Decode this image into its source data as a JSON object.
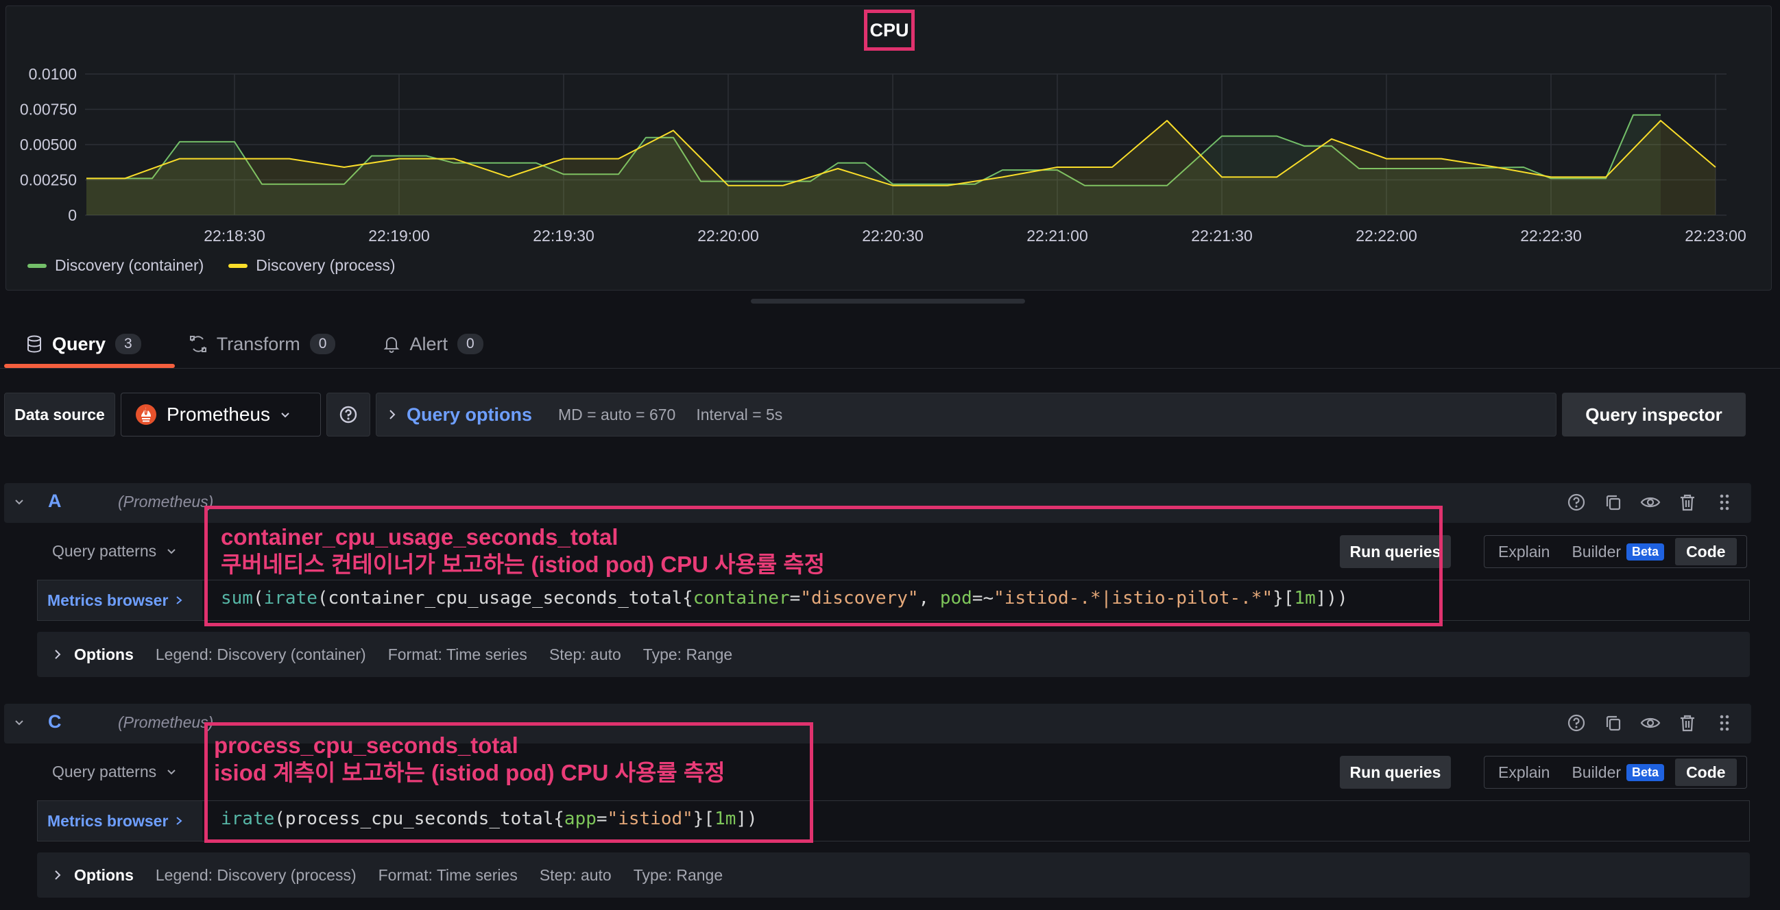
{
  "panel": {
    "title": "CPU",
    "legend": [
      {
        "label": "Discovery (container)",
        "color": "#73bf69"
      },
      {
        "label": "Discovery (process)",
        "color": "#fade2a"
      }
    ]
  },
  "chart_data": {
    "type": "line",
    "title": "CPU",
    "y_ticks": [
      "0.0100",
      "0.00750",
      "0.00500",
      "0.00250",
      "0"
    ],
    "ylim": [
      0,
      0.01
    ],
    "x_ticks": [
      "22:18:30",
      "22:19:00",
      "22:19:30",
      "22:20:00",
      "22:20:30",
      "22:21:00",
      "22:21:30",
      "22:22:00",
      "22:22:30",
      "22:23:00"
    ],
    "grid": true,
    "legend_placement": "bottom-left",
    "series": [
      {
        "name": "Discovery (container)",
        "color": "#73bf69",
        "x": [
          "22:18:03",
          "22:18:15",
          "22:18:20",
          "22:18:30",
          "22:18:35",
          "22:18:50",
          "22:18:55",
          "22:19:05",
          "22:19:10",
          "22:19:25",
          "22:19:30",
          "22:19:40",
          "22:19:45",
          "22:19:50",
          "22:19:55",
          "22:20:05",
          "22:20:15",
          "22:20:20",
          "22:20:25",
          "22:20:30",
          "22:20:45",
          "22:20:50",
          "22:21:00",
          "22:21:05",
          "22:21:20",
          "22:21:30",
          "22:21:40",
          "22:21:45",
          "22:21:50",
          "22:21:55",
          "22:22:10",
          "22:22:25",
          "22:22:30",
          "22:22:40",
          "22:22:45",
          "22:22:50"
        ],
        "values": [
          0.0026,
          0.0026,
          0.0052,
          0.0052,
          0.0022,
          0.0022,
          0.0042,
          0.0042,
          0.0037,
          0.0037,
          0.0029,
          0.0029,
          0.0055,
          0.0055,
          0.0024,
          0.0024,
          0.0024,
          0.0037,
          0.0037,
          0.0022,
          0.0022,
          0.0032,
          0.0032,
          0.0021,
          0.0021,
          0.0056,
          0.0056,
          0.0049,
          0.0049,
          0.0033,
          0.0033,
          0.0034,
          0.0026,
          0.0026,
          0.0071,
          0.0071
        ]
      },
      {
        "name": "Discovery (process)",
        "color": "#fade2a",
        "x": [
          "22:18:03",
          "22:18:10",
          "22:18:20",
          "22:18:30",
          "22:18:40",
          "22:18:50",
          "22:19:00",
          "22:19:10",
          "22:19:20",
          "22:19:30",
          "22:19:40",
          "22:19:50",
          "22:20:00",
          "22:20:10",
          "22:20:20",
          "22:20:30",
          "22:20:40",
          "22:20:50",
          "22:21:00",
          "22:21:10",
          "22:21:20",
          "22:21:30",
          "22:21:40",
          "22:21:50",
          "22:22:00",
          "22:22:10",
          "22:22:20",
          "22:22:30",
          "22:22:40",
          "22:22:50",
          "22:23:00"
        ],
        "values": [
          0.0026,
          0.0026,
          0.004,
          0.004,
          0.004,
          0.0034,
          0.004,
          0.004,
          0.0027,
          0.004,
          0.004,
          0.006,
          0.0021,
          0.0021,
          0.0033,
          0.0021,
          0.0021,
          0.0027,
          0.0034,
          0.0034,
          0.0067,
          0.0027,
          0.0027,
          0.0054,
          0.004,
          0.004,
          0.0034,
          0.0027,
          0.0027,
          0.0067,
          0.0034
        ]
      }
    ]
  },
  "tabs": [
    {
      "label": "Query",
      "count": "3"
    },
    {
      "label": "Transform",
      "count": "0"
    },
    {
      "label": "Alert",
      "count": "0"
    }
  ],
  "datasource": {
    "label": "Data source",
    "name": "Prometheus",
    "query_options_label": "Query options",
    "md": "MD = auto = 670",
    "interval": "Interval = 5s",
    "inspector": "Query inspector"
  },
  "queries": [
    {
      "letter": "A",
      "source": "(Prometheus)",
      "patterns": "Query patterns",
      "run": "Run queries",
      "modes": {
        "explain": "Explain",
        "builder": "Builder",
        "beta": "Beta",
        "code": "Code"
      },
      "metrics_browser": "Metrics browser",
      "expr": {
        "t1": "sum",
        "t2": "(",
        "t3": "irate",
        "t4": "(container_cpu_usage_seconds_total{",
        "t5": "container",
        "t6": "=",
        "t7": "\"discovery\"",
        "t8": ", ",
        "t9": "pod",
        "t10": "=~",
        "t11": "\"istiod-.*|istio-pilot-.*\"",
        "t12": "}[",
        "t13": "1m",
        "t14": "]))"
      },
      "options": {
        "title": "Options",
        "legend": "Legend: Discovery (container)",
        "format": "Format: Time series",
        "step": "Step: auto",
        "type": "Type: Range"
      },
      "annotation": {
        "line1": "container_cpu_usage_seconds_total",
        "line2": "쿠버네티스 컨테이너가 보고하는 (istiod pod) CPU 사용률 측정"
      }
    },
    {
      "letter": "C",
      "source": "(Prometheus)",
      "patterns": "Query patterns",
      "run": "Run queries",
      "modes": {
        "explain": "Explain",
        "builder": "Builder",
        "beta": "Beta",
        "code": "Code"
      },
      "metrics_browser": "Metrics browser",
      "expr": {
        "t1": "irate",
        "t2": "(process_cpu_seconds_total{",
        "t3": "app",
        "t4": "=",
        "t5": "\"istiod\"",
        "t6": "}[",
        "t7": "1m",
        "t8": "])"
      },
      "options": {
        "title": "Options",
        "legend": "Legend: Discovery (process)",
        "format": "Format: Time series",
        "step": "Step: auto",
        "type": "Type: Range"
      },
      "annotation": {
        "line1": "process_cpu_seconds_total",
        "line2": "isiod 계측이 보고하는 (istiod pod) CPU 사용률 측정"
      }
    }
  ]
}
